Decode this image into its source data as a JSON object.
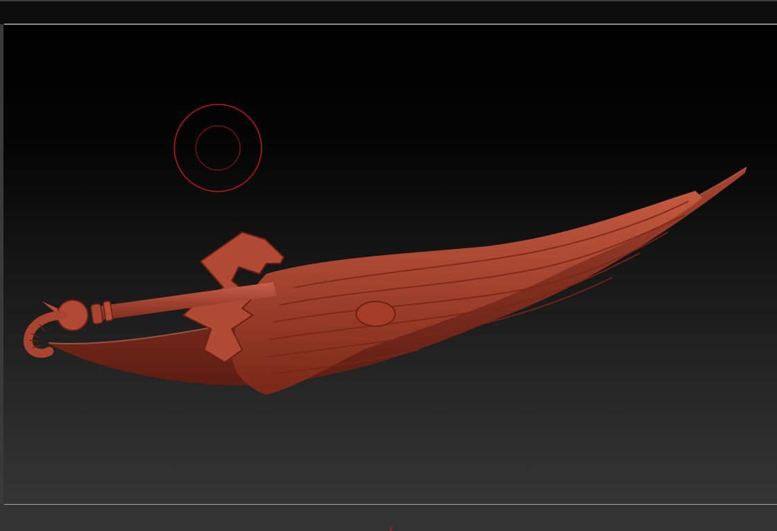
{
  "app": {
    "type": "3d-sculpting-viewport"
  },
  "viewport": {
    "background_top": "#000000",
    "background_bottom": "#353535"
  },
  "brush_cursor": {
    "outer_color": "#c8141e",
    "inner_color": "#8c1418"
  },
  "model": {
    "icon": "sculpted-blade-mesh",
    "material_color": "#b4503a"
  }
}
